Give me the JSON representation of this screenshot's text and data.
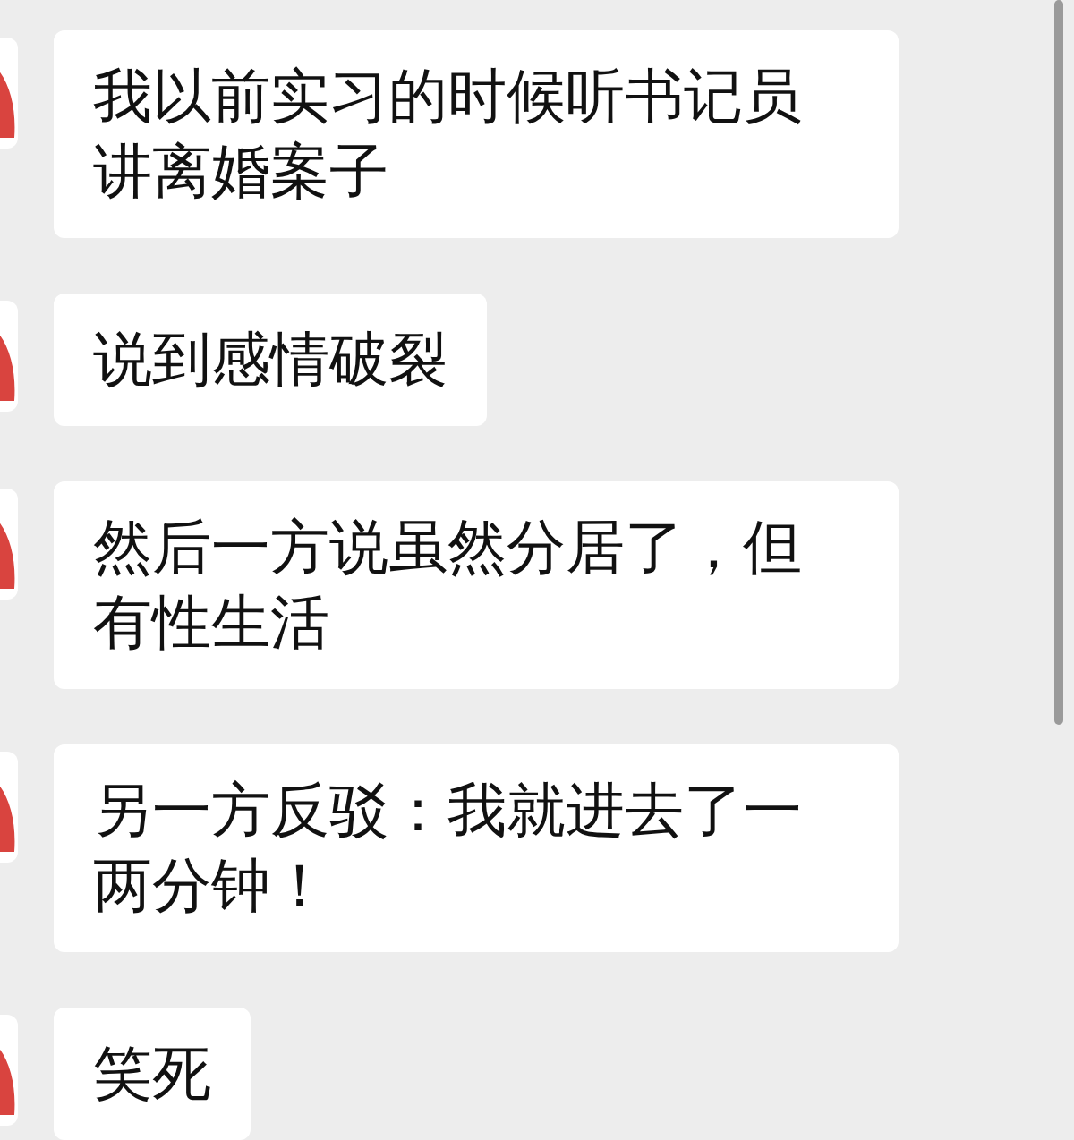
{
  "messages": [
    {
      "text": "我以前实习的时候听书记员讲离婚案子"
    },
    {
      "text": "说到感情破裂"
    },
    {
      "text": "然后一方说虽然分居了，但有性生活"
    },
    {
      "text": "另一方反驳：我就进去了一两分钟！"
    },
    {
      "text": "笑死"
    }
  ]
}
